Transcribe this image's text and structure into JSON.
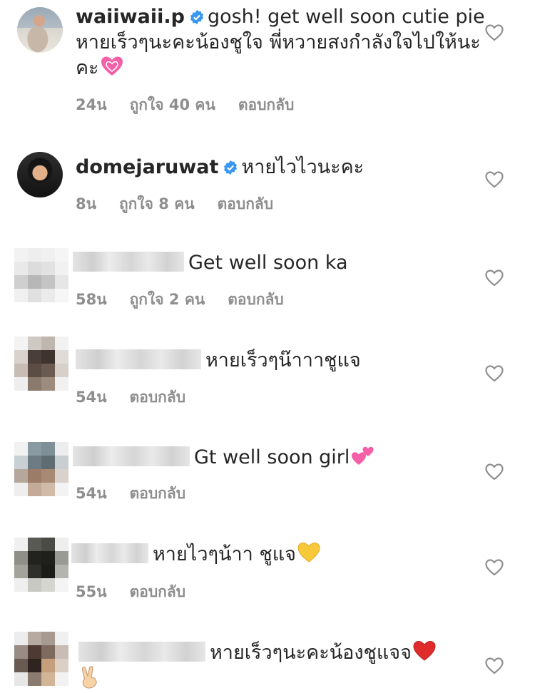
{
  "comments": [
    {
      "username": "waiiwaii.p",
      "verified": true,
      "text": "gosh! get well soon cutie pie หายเร็วๆนะคะน้องชูใจ พี่หวายสงกำลังใจไปให้นะคะ",
      "emoji": "growing-heart",
      "time": "24น",
      "likes": "ถูกใจ 40 คน",
      "reply": "ตอบกลับ"
    },
    {
      "username": "domejaruwat",
      "verified": true,
      "text": "หายไวไวนะคะ",
      "time": "8น",
      "likes": "ถูกใจ 8 คน",
      "reply": "ตอบกลับ"
    },
    {
      "username_blurred": true,
      "text": "Get well soon ka",
      "time": "58น",
      "likes": "ถูกใจ 2 คน",
      "reply": "ตอบกลับ"
    },
    {
      "username_blurred": true,
      "text": "หายเร็วๆน๊าาาชูแจ",
      "time": "54น",
      "reply": "ตอบกลับ"
    },
    {
      "username_blurred": true,
      "text": "Gt well soon girl",
      "emoji": "two-hearts",
      "time": "54น",
      "reply": "ตอบกลับ"
    },
    {
      "username_blurred": true,
      "text": "หายไวๆน้าา ชูแจ",
      "emoji": "yellow-heart",
      "time": "55น",
      "reply": "ตอบกลับ"
    },
    {
      "username_blurred": true,
      "text": "หายเร็วๆนะคะน้องชูแจจ",
      "emoji": "red-heart",
      "extra_emoji": "victory-hand",
      "reply": ""
    }
  ],
  "colors": {
    "text": "#262626",
    "meta": "#8e8e8e",
    "verified": "#3897f0",
    "heart_outline": "#8e8e8e"
  }
}
